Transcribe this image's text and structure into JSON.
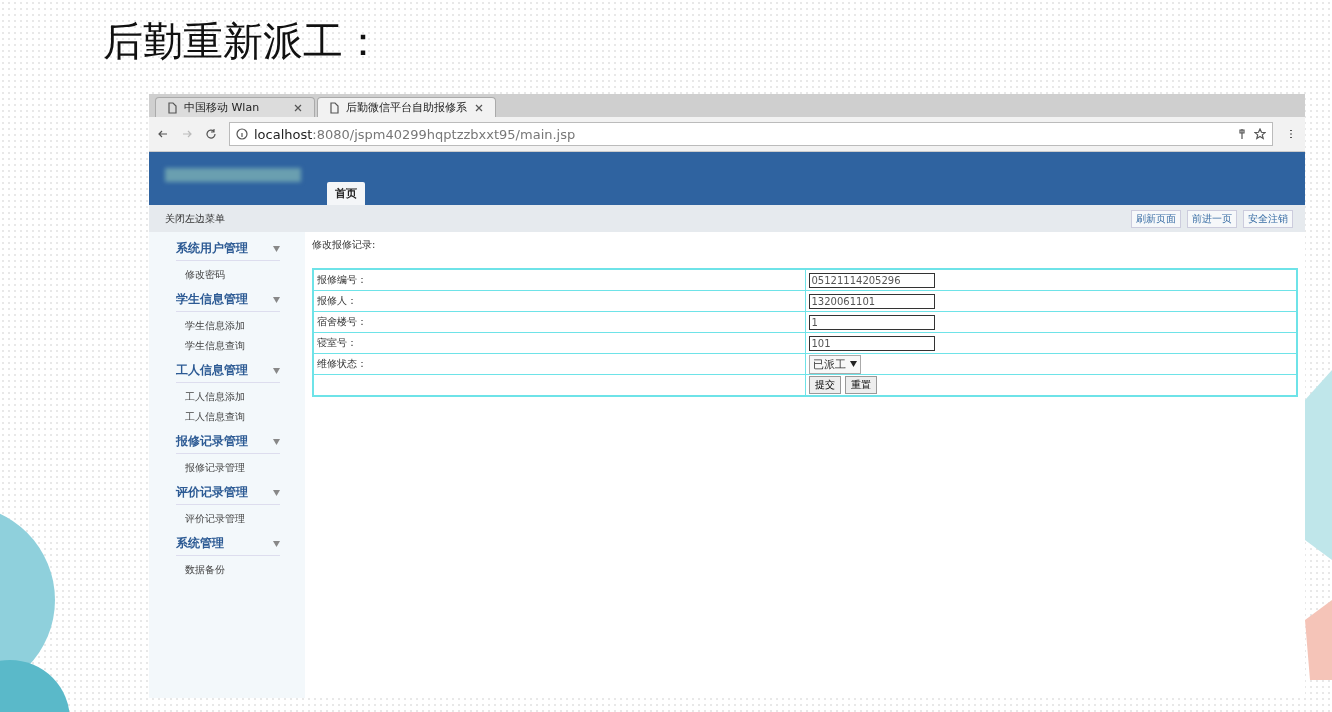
{
  "slide": {
    "title": "后勤重新派工："
  },
  "browser": {
    "tabs": [
      {
        "label": "中国移动 Wlan",
        "selected": false
      },
      {
        "label": "后勤微信平台自助报修系",
        "selected": true
      }
    ],
    "url": {
      "host": "localhost",
      "path": ":8080/jspm40299hqptzzbxxt95/main.jsp"
    }
  },
  "header": {
    "nav_tabs": [
      {
        "label": "首页",
        "selected": true
      }
    ]
  },
  "toolbar": {
    "toggle": "关闭左边菜单",
    "buttons": [
      "刷新页面",
      "前进一页",
      "安全注销"
    ]
  },
  "sidebar": {
    "groups": [
      {
        "title": "系统用户管理",
        "expanded": true,
        "items": [
          "修改密码"
        ]
      },
      {
        "title": "学生信息管理",
        "expanded": true,
        "items": [
          "学生信息添加",
          "学生信息查询"
        ]
      },
      {
        "title": "工人信息管理",
        "expanded": true,
        "items": [
          "工人信息添加",
          "工人信息查询"
        ]
      },
      {
        "title": "报修记录管理",
        "expanded": true,
        "items": [
          "报修记录管理"
        ]
      },
      {
        "title": "评价记录管理",
        "expanded": true,
        "items": [
          "评价记录管理"
        ]
      },
      {
        "title": "系统管理",
        "expanded": true,
        "items": [
          "数据备份"
        ]
      }
    ]
  },
  "form": {
    "heading": "修改报修记录:",
    "fields": [
      {
        "kind": "text",
        "label": "报修编号：",
        "value": "05121114205296"
      },
      {
        "kind": "text",
        "label": "报修人：",
        "value": "1320061101"
      },
      {
        "kind": "text",
        "label": "宿舍楼号：",
        "value": "1"
      },
      {
        "kind": "text",
        "label": "寝室号：",
        "value": "101"
      },
      {
        "kind": "select",
        "label": "维修状态：",
        "value": "已派工"
      }
    ],
    "buttons": [
      "提交",
      "重置"
    ]
  }
}
